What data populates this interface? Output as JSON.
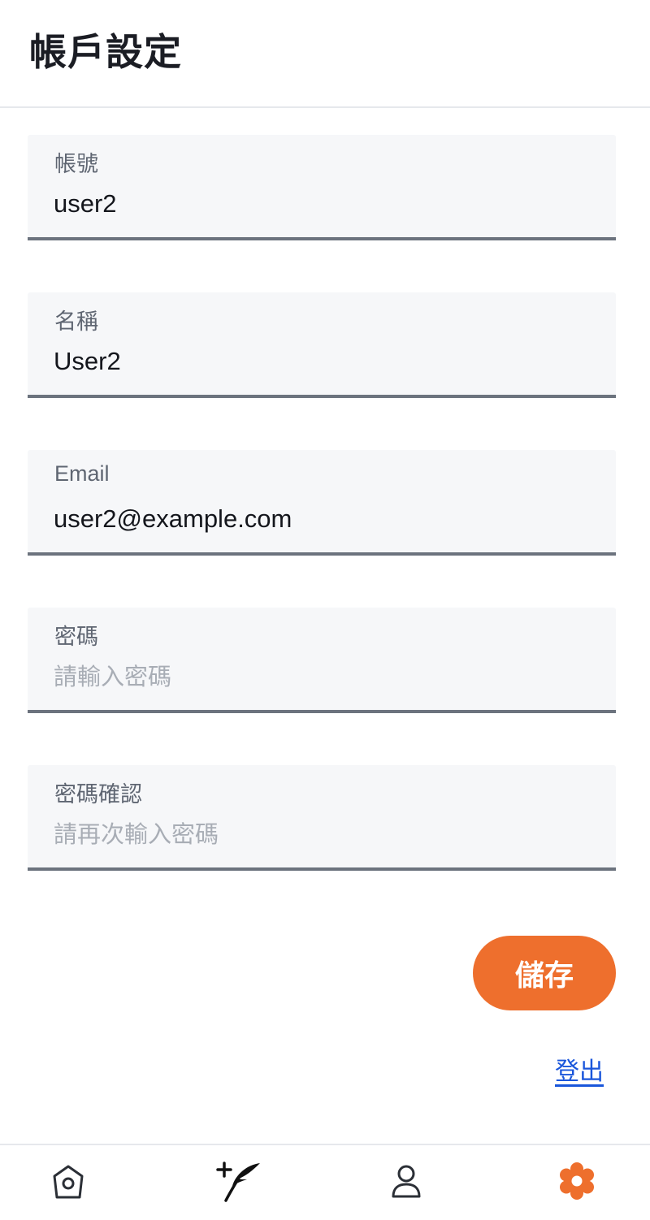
{
  "header": {
    "title": "帳戶設定"
  },
  "form": {
    "fields": [
      {
        "label": "帳號",
        "value": "user2",
        "placeholder": ""
      },
      {
        "label": "名稱",
        "value": "User2",
        "placeholder": ""
      },
      {
        "label": "Email",
        "value": "user2@example.com",
        "placeholder": ""
      },
      {
        "label": "密碼",
        "value": "",
        "placeholder": "請輸入密碼"
      },
      {
        "label": "密碼確認",
        "value": "",
        "placeholder": "請再次輸入密碼"
      }
    ],
    "save_label": "儲存",
    "logout_label": "登出"
  },
  "bottom_nav": {
    "items": [
      {
        "icon": "home-icon",
        "active": false
      },
      {
        "icon": "compose-icon",
        "active": false
      },
      {
        "icon": "profile-icon",
        "active": false
      },
      {
        "icon": "settings-icon",
        "active": true
      }
    ],
    "active_color": "#ee6f2d",
    "inactive_color": "#2b2f36"
  },
  "colors": {
    "accent": "#ee6f2d",
    "link": "#1a56db"
  }
}
